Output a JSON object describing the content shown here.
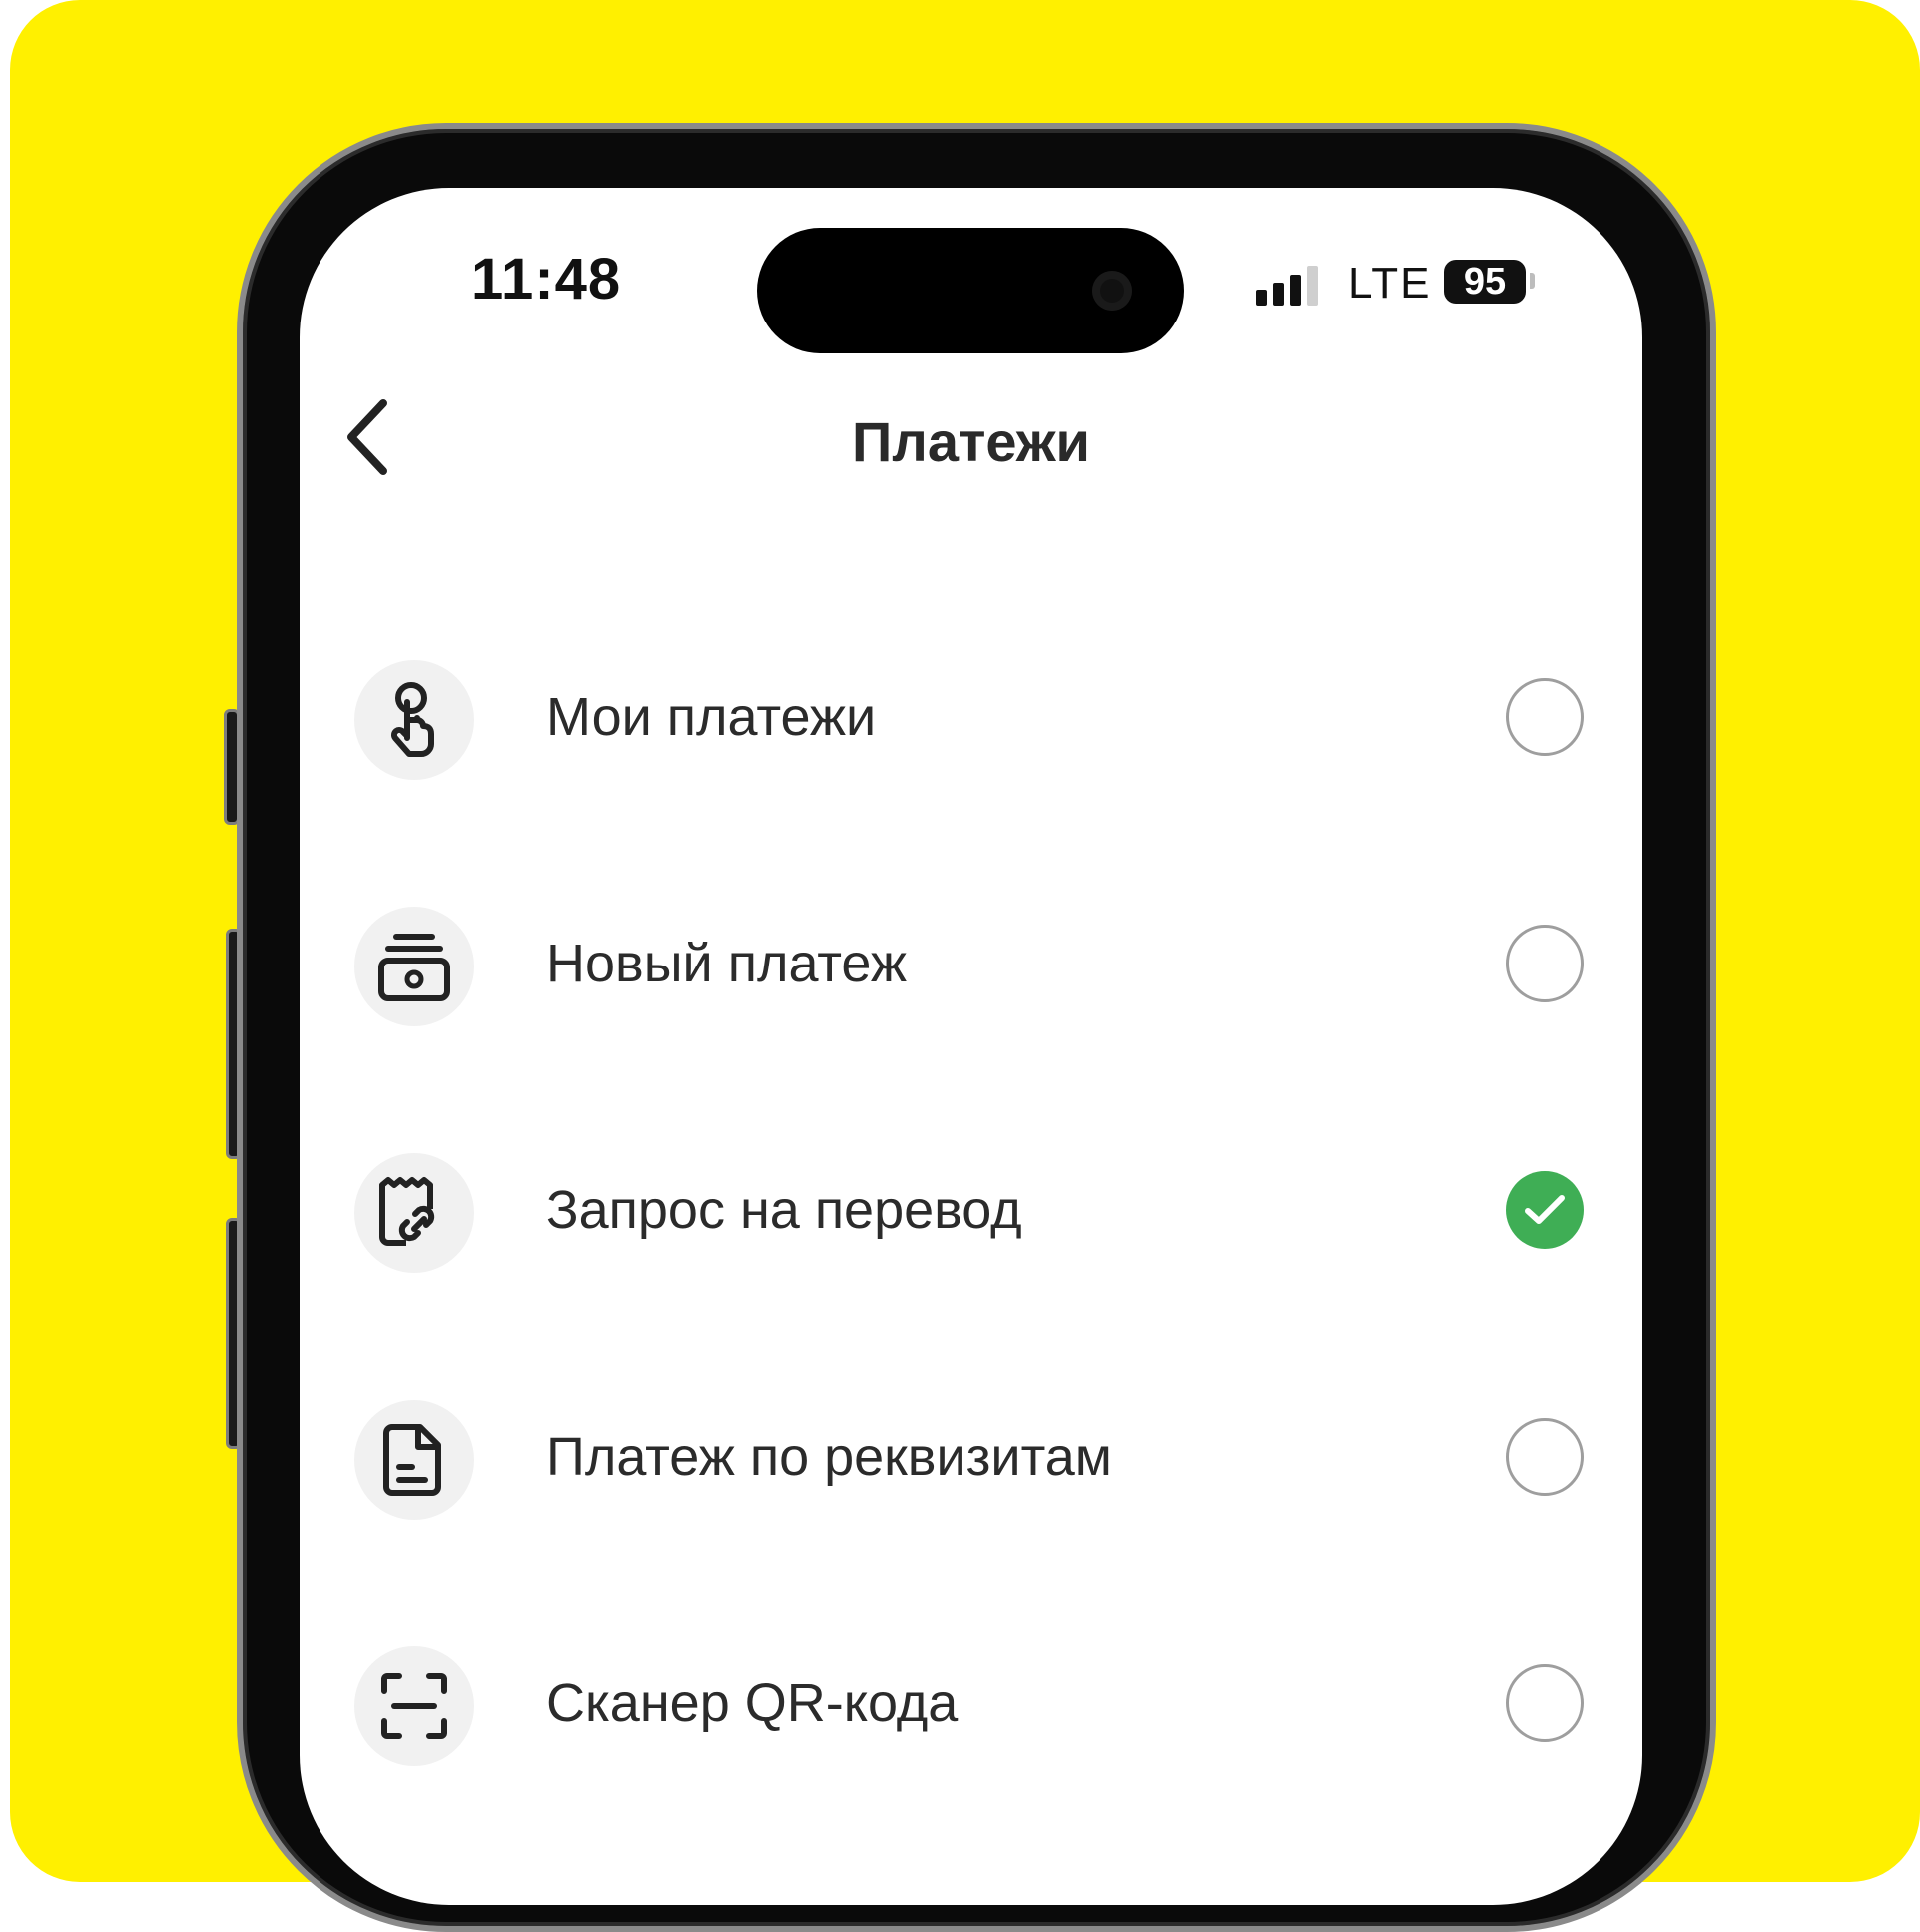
{
  "status_bar": {
    "time": "11:48",
    "network": "LTE",
    "battery": "95"
  },
  "header": {
    "title": "Платежи",
    "back_icon": "chevron-left-icon"
  },
  "colors": {
    "background": "#fff000",
    "check_accent": "#3fae55",
    "text": "#2b2b2b"
  },
  "items": [
    {
      "label": "Мои платежи",
      "icon": "hand-pointer-icon",
      "selected": false
    },
    {
      "label": "Новый платеж",
      "icon": "cash-stack-icon",
      "selected": false
    },
    {
      "label": "Запрос на перевод",
      "icon": "receipt-link-icon",
      "selected": true
    },
    {
      "label": "Платеж по реквизитам",
      "icon": "document-icon",
      "selected": false
    },
    {
      "label": "Сканер QR-кода",
      "icon": "qr-scan-icon",
      "selected": false
    }
  ]
}
